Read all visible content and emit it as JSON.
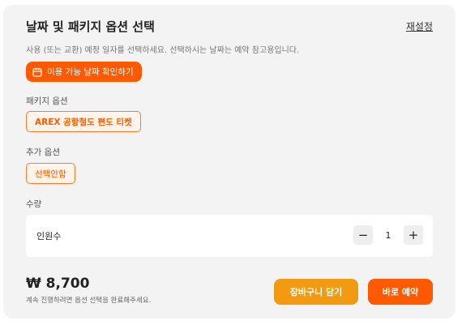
{
  "header": {
    "title": "날짜 및 패키지 옵션 선택",
    "reset_label": "재설정"
  },
  "description": "사용 (또는 교환) 예정 일자를 선택하세요. 선택하시는 날짜는 예약 참고용입니다.",
  "date_button": {
    "label": "이용 가능 날짜 확인하기",
    "icon": "calendar-icon"
  },
  "package": {
    "label": "패키지 옵션",
    "selected": "AREX 공항철도 편도 티켓"
  },
  "addon": {
    "label": "추가 옵션",
    "selected": "선택안함"
  },
  "quantity": {
    "label": "수량",
    "row_label": "인원수",
    "value": "1",
    "minus": "−",
    "plus": "+"
  },
  "footer": {
    "price": "₩ 8,700",
    "note": "계속 진행하려면 옵션 선택을 완료해주세요.",
    "cart_label": "장바구니 담기",
    "book_label": "바로 예약"
  },
  "colors": {
    "accent": "#ff5a00",
    "cart": "#f39a13",
    "panel": "#f3f3f3"
  }
}
